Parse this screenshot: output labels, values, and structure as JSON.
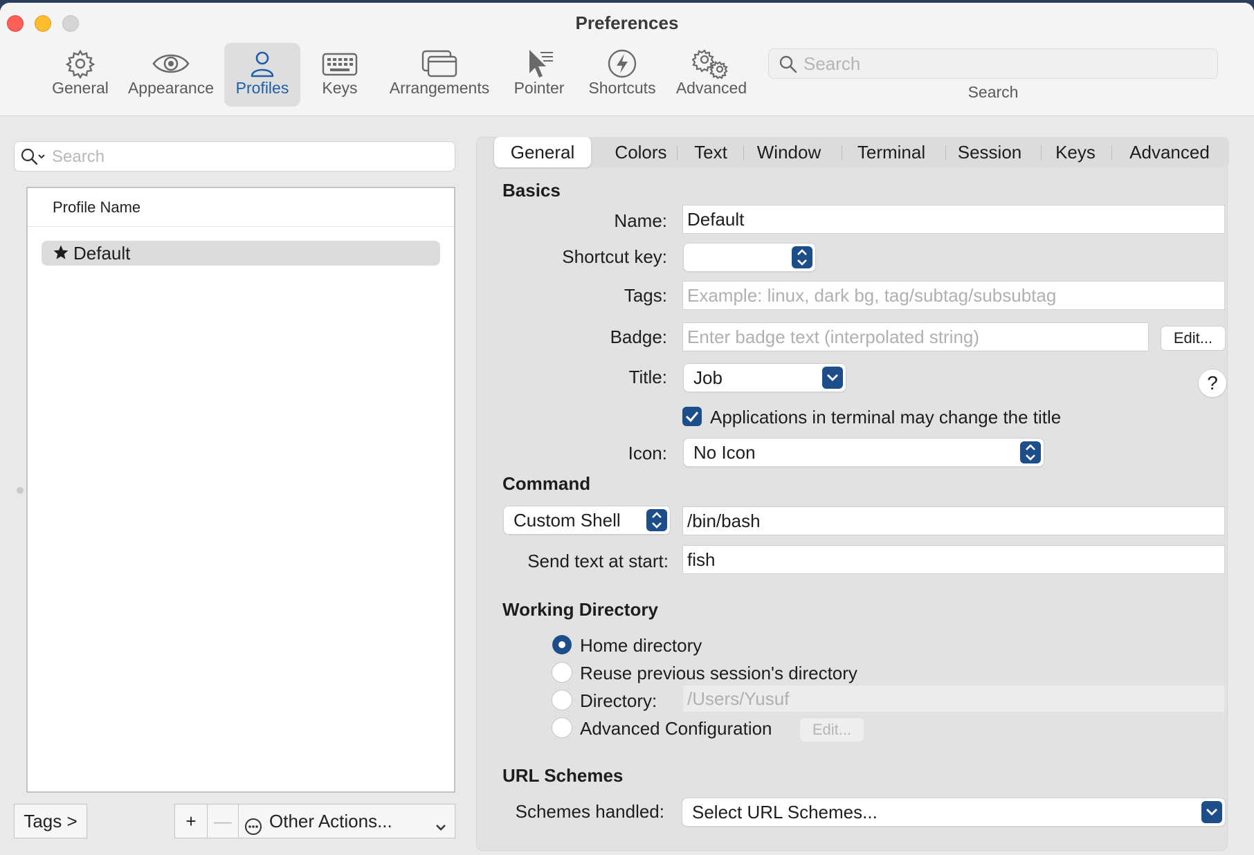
{
  "window": {
    "title": "Preferences"
  },
  "toolbar": {
    "items": [
      {
        "label": "General",
        "icon": "gear-icon"
      },
      {
        "label": "Appearance",
        "icon": "eye-icon"
      },
      {
        "label": "Profiles",
        "icon": "person-icon"
      },
      {
        "label": "Keys",
        "icon": "keyboard-icon"
      },
      {
        "label": "Arrangements",
        "icon": "windows-icon"
      },
      {
        "label": "Pointer",
        "icon": "pointer-icon"
      },
      {
        "label": "Shortcuts",
        "icon": "lightning-icon"
      },
      {
        "label": "Advanced",
        "icon": "gears-icon"
      }
    ],
    "active": "Profiles",
    "search_placeholder": "Search",
    "search_label": "Search"
  },
  "sidebar": {
    "search_placeholder": "Search",
    "column_header": "Profile Name",
    "profiles": [
      {
        "name": "Default",
        "is_default": true
      }
    ],
    "tags_button": "Tags >",
    "add_button": "+",
    "remove_button": "—",
    "other_actions": "Other Actions..."
  },
  "tabs": {
    "items": [
      "General",
      "Colors",
      "Text",
      "Window",
      "Terminal",
      "Session",
      "Keys",
      "Advanced"
    ],
    "active": "General"
  },
  "basics": {
    "heading": "Basics",
    "name_label": "Name:",
    "name_value": "Default",
    "shortcut_label": "Shortcut key:",
    "shortcut_value": "",
    "tags_label": "Tags:",
    "tags_placeholder": "Example: linux, dark bg, tag/subtag/subsubtag",
    "badge_label": "Badge:",
    "badge_placeholder": "Enter badge text (interpolated string)",
    "badge_edit": "Edit...",
    "title_label": "Title:",
    "title_value": "Job",
    "help": "?",
    "apps_change_title": "Applications in terminal may change the title",
    "apps_change_title_checked": true,
    "icon_label": "Icon:",
    "icon_value": "No Icon"
  },
  "command": {
    "heading": "Command",
    "type_value": "Custom Shell",
    "command_value": "/bin/bash",
    "send_text_label": "Send text at start:",
    "send_text_value": "fish"
  },
  "working_directory": {
    "heading": "Working Directory",
    "options": [
      {
        "label": "Home directory",
        "selected": true
      },
      {
        "label": "Reuse previous session's directory",
        "selected": false
      },
      {
        "label": "Directory:",
        "selected": false
      },
      {
        "label": "Advanced Configuration",
        "selected": false
      }
    ],
    "directory_placeholder": "/Users/Yusuf",
    "advanced_edit": "Edit..."
  },
  "url_schemes": {
    "heading": "URL Schemes",
    "label": "Schemes handled:",
    "value": "Select URL Schemes..."
  },
  "colors": {
    "accent": "#1d4e89",
    "active_toolbar": "#1f5fa8"
  }
}
